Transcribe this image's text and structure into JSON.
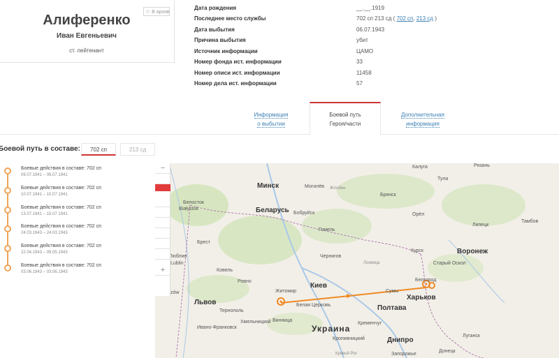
{
  "profile": {
    "archive_label": "В архив",
    "surname": "Алиференко",
    "given_names": "Иван Евгеньевич",
    "rank": "ст. лейтенант"
  },
  "info": {
    "rows": [
      {
        "label": "Дата рождения",
        "value": "__.__.1919"
      },
      {
        "label": "Последнее место службы",
        "value": "702 сп 213 сд (",
        "links": [
          "702 сп",
          "213 сд"
        ],
        "suffix": ")"
      },
      {
        "label": "Дата выбытия",
        "value": "06.07.1943"
      },
      {
        "label": "Причина выбытия",
        "value": "убит"
      },
      {
        "label": "Источник информации",
        "value": "ЦАМО"
      },
      {
        "label": "Номер фонда ист. информации",
        "value": "33"
      },
      {
        "label": "Номер описи ист. информации",
        "value": "11458"
      },
      {
        "label": "Номер дела ист. информации",
        "value": "57"
      }
    ]
  },
  "tabs": {
    "left": {
      "line1": "Информация",
      "line2": "о выбытии"
    },
    "active": {
      "line1": "Боевой путь",
      "line2": "Героя/части"
    },
    "right": {
      "line1": "Дополнительная",
      "line2": "информация"
    }
  },
  "path": {
    "title": "Боевой путь в составе:",
    "units": [
      "702 сп",
      "213 сд"
    ]
  },
  "timeline": [
    {
      "title": "Боевые действия в составе: 702 сп",
      "dates": "09.07.1941 – 09.07.1941"
    },
    {
      "title": "Боевые действия в составе: 702 сп",
      "dates": "10.07.1941 – 10.07.1941"
    },
    {
      "title": "Боевые действия в составе: 702 сп",
      "dates": "13.07.1941 – 15.07.1941"
    },
    {
      "title": "Боевые действия в составе: 702 сп",
      "dates": "24.03.1943 – 24.03.1943"
    },
    {
      "title": "Боевые действия в составе: 702 сп",
      "dates": "22.04.1943 – 09.05.1943"
    },
    {
      "title": "Боевые действия в составе: 702 сп",
      "dates": "03.06.1943 – 03.06.1943"
    }
  ],
  "map": {
    "labels": {
      "minsk": "Минск",
      "mogilev": "Могилёв",
      "belarus": "Беларусь",
      "bobruisk": "Бобруйск",
      "gomel": "Гомель",
      "belostok": "Белосток",
      "bialystok": "Białystok",
      "brest": "Брест",
      "lublin_ru": "Люблин",
      "lublin": "Lublin",
      "kowel": "Ковель",
      "rovno": "Ровно",
      "zhitomir": "Житомир",
      "kiev": "Киев",
      "lvov": "Львов",
      "ternopol": "Тернополь",
      "khmelnitsky": "Хмельницкий",
      "vinnitsa": "Винница",
      "belaya_tserkov": "Белая Церковь",
      "ukraina": "Украина",
      "poltava": "Полтава",
      "sumy": "Сумы",
      "kharkov": "Харьков",
      "kursk": "Курск",
      "voronezh": "Воронеж",
      "stary_oskol": "Старый Оскол",
      "belgorod": "Белгород",
      "bryansk": "Брянск",
      "orel": "Орёл",
      "lipetsk": "Липецк",
      "tambov": "Тамбов",
      "tula": "Тула",
      "kaluga": "Калуга",
      "ryazan": "Рязань",
      "chernigov": "Чернигов",
      "kremenchug": "Кременчуг",
      "dnipro": "Днипро",
      "kropivnitsky": "Кропивницкий",
      "ivano_frankovsk": "Ивано-Франковск",
      "zaporozhye": "Запорожье",
      "donetsk": "Донецк",
      "lugansk": "Луганск",
      "krivoy_rog": "Кривой Рог",
      "rzeszow": "Rzeszów",
      "zhlobin": "Жлобин",
      "lokhvitsa": "Лохвица"
    },
    "colors": {
      "route": "#f08a24",
      "land": "#f2efe8",
      "forest": "#cfe3b5",
      "water": "#a9c8e8"
    }
  }
}
